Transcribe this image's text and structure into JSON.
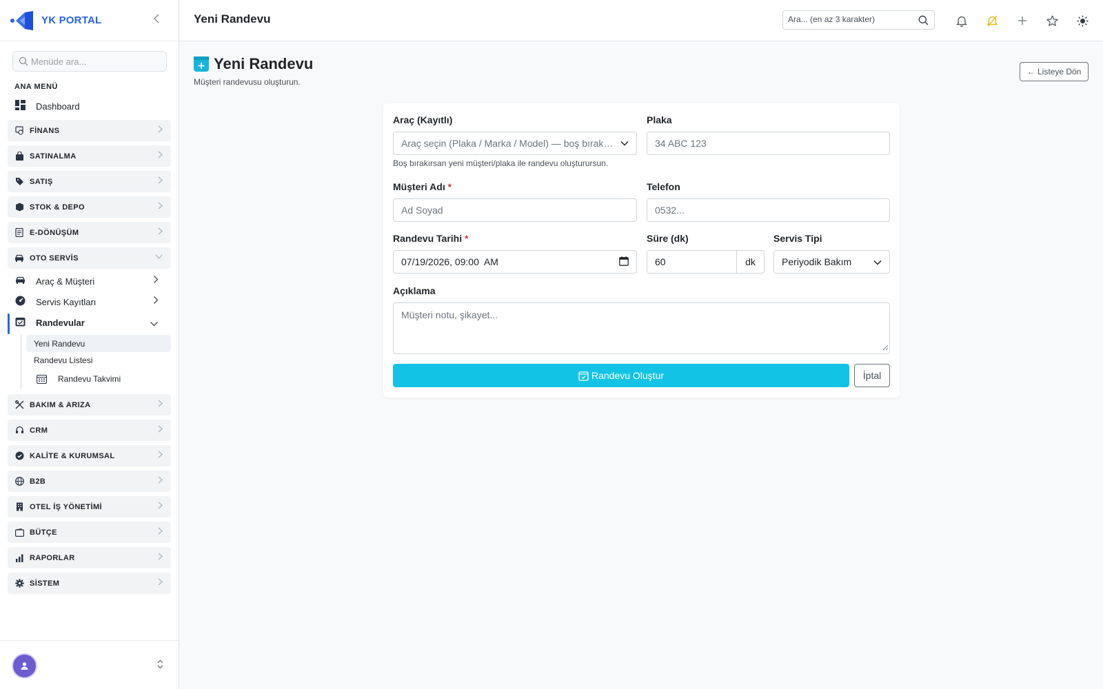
{
  "brand": {
    "name": "YK PORTAL",
    "accent": "#2563eb"
  },
  "sidebar": {
    "search_placeholder": "Menüde ara...",
    "section_title": "ANA MENÜ",
    "dashboard": "Dashboard",
    "groups_top": [
      {
        "label": "FİNANS",
        "icon": "finance-icon"
      },
      {
        "label": "SATINALMA",
        "icon": "shopping-bag-icon"
      },
      {
        "label": "SATIŞ",
        "icon": "tag-icon"
      },
      {
        "label": "STOK & DEPO",
        "icon": "box-icon"
      },
      {
        "label": "E-DÖNÜŞÜM",
        "icon": "document-icon"
      },
      {
        "label": "OTO SERVİS",
        "icon": "car-icon",
        "expanded": true
      }
    ],
    "oto_servis_items": [
      {
        "label": "Araç & Müşteri",
        "icon": "car-icon"
      },
      {
        "label": "Servis Kayıtları",
        "icon": "gauge-icon"
      },
      {
        "label": "Randevular",
        "icon": "calendar-check-icon",
        "expanded": true
      }
    ],
    "randevular_items": [
      {
        "label": "Yeni Randevu",
        "selected": true
      },
      {
        "label": "Randevu Listesi"
      },
      {
        "label": "Randevu Takvimi",
        "icon": "calendar-icon"
      }
    ],
    "groups_bottom": [
      {
        "label": "BAKIM & ARIZA",
        "icon": "tools-icon"
      },
      {
        "label": "CRM",
        "icon": "headset-icon"
      },
      {
        "label": "KALİTE & KURUMSAL",
        "icon": "badge-check-icon"
      },
      {
        "label": "B2B",
        "icon": "globe-icon"
      },
      {
        "label": "OTEL İŞ YÖNETİMİ",
        "icon": "building-icon"
      },
      {
        "label": "BÜTÇE",
        "icon": "wallet-icon"
      },
      {
        "label": "RAPORLAR",
        "icon": "bar-chart-icon"
      },
      {
        "label": "SİSTEM",
        "icon": "gear-icon"
      }
    ]
  },
  "topbar": {
    "title": "Yeni Randevu",
    "search_placeholder": "Ara... (en az 3 karakter)"
  },
  "page": {
    "title": "Yeni Randevu",
    "subtitle": "Müşteri randevusu oluşturun.",
    "back_label": "← Listeye Dön"
  },
  "form": {
    "vehicle_label": "Araç (Kayıtlı)",
    "vehicle_placeholder": "Araç seçin (Plaka / Marka / Model) — boş bırakılabilir",
    "vehicle_help": "Boş bırakırsan yeni müşteri/plaka ile randevu oluşturursun.",
    "plate_label": "Plaka",
    "plate_placeholder": "34 ABC 123",
    "customer_label": "Müşteri Adı",
    "customer_placeholder": "Ad Soyad",
    "phone_label": "Telefon",
    "phone_placeholder": "0532...",
    "date_label": "Randevu Tarihi",
    "date_value": "07/19/2026, 09:00  AM",
    "duration_label": "Süre (dk)",
    "duration_value": "60",
    "duration_unit": "dk",
    "service_label": "Servis Tipi",
    "service_value": "Periyodik Bakım",
    "desc_label": "Açıklama",
    "desc_placeholder": "Müşteri notu, şikayet...",
    "required_mark": "*",
    "submit_label": "Randevu Oluştur",
    "cancel_label": "İptal",
    "submit_color": "#13c3e6"
  }
}
